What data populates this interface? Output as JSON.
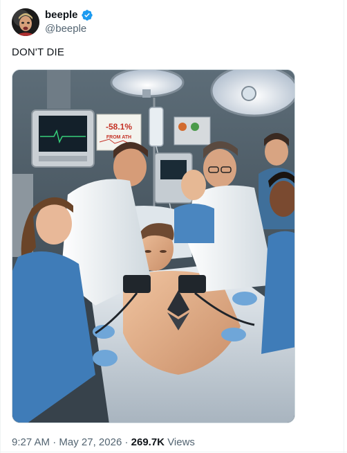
{
  "author": {
    "display_name": "beeple",
    "handle": "@beeple",
    "verified": true,
    "verified_color": "#1d9bf0"
  },
  "tweet": {
    "text": "DON'T DIE"
  },
  "media": {
    "monitor_sign": {
      "value": "-58.1%",
      "caption": "FROM ATH"
    }
  },
  "meta": {
    "time": "9:27 AM",
    "separator": "·",
    "date": "May 27, 2026",
    "views_count": "269.7K",
    "views_label": "Views"
  },
  "icons": [
    "verified-badge-icon",
    "ethereum-logo-icon"
  ]
}
